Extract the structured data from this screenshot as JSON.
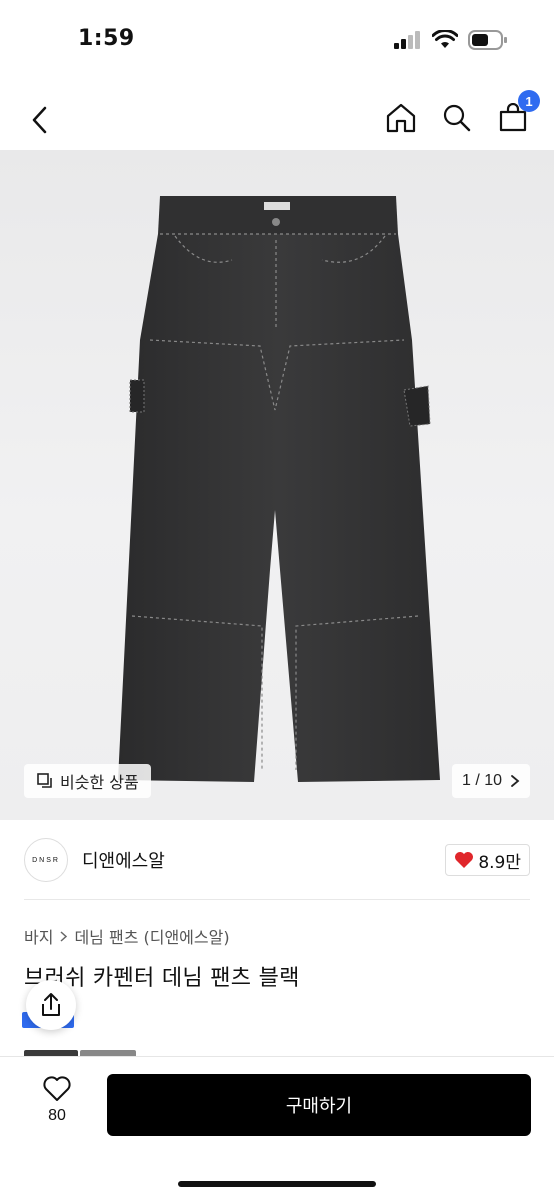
{
  "status_bar": {
    "time": "1:59"
  },
  "nav": {
    "cart_count": "1",
    "icons": [
      "back-icon",
      "home-icon",
      "search-icon",
      "cart-icon"
    ]
  },
  "product_image": {
    "similar_label": "비슷한 상품",
    "page_indicator": "1 / 10"
  },
  "brand": {
    "logo_text": "DNSR",
    "name": "디앤에스알",
    "likes": "8.9만"
  },
  "breadcrumb": {
    "category": "바지",
    "subcategory": "데님 팬츠 (디앤에스알)"
  },
  "product": {
    "title": "브러쉬 카펜터 데님 팬츠 블랙"
  },
  "bottom_bar": {
    "wish_count": "80",
    "buy_label": "구매하기"
  },
  "colors": {
    "accent": "#2f6bf0",
    "like_heart": "#e0262b",
    "buy_button": "#000000"
  }
}
